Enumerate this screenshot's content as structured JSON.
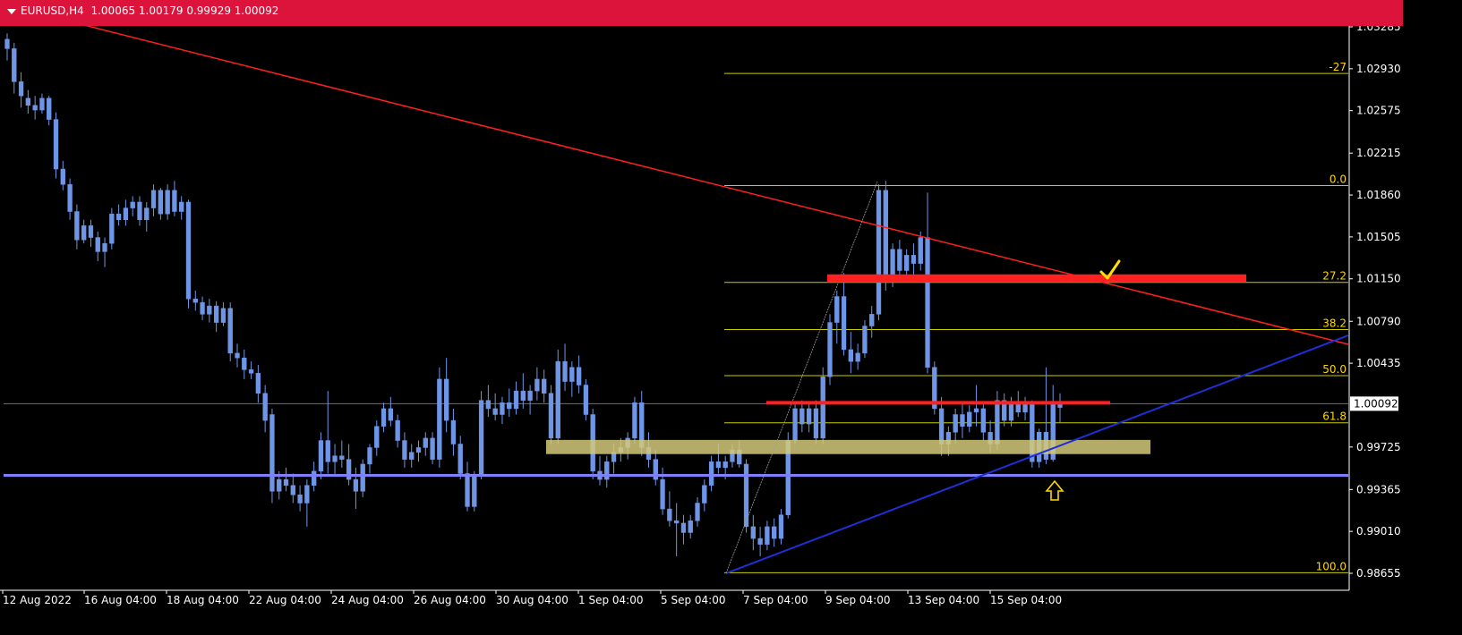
{
  "header": {
    "symbol": "EURUSD,H4",
    "ohlc": "1.00065 1.00179 0.99929 1.00092"
  },
  "current_price_label": "1.00092",
  "colors": {
    "bull": "#6f96e6",
    "bear": "#6f96e6",
    "background": "#000000",
    "fib": "#cccc00",
    "trend_red": "#ff2020",
    "trend_blue": "#1f2fd8",
    "support_line": "#8080ff",
    "zone": "#d4c97a",
    "arrow": "#ffd700"
  },
  "chart_data": {
    "type": "candlestick",
    "symbol": "EURUSD",
    "timeframe": "H4",
    "y_ticks": [
      "1.03285",
      "1.02930",
      "1.02575",
      "1.02215",
      "1.01860",
      "1.01505",
      "1.01150",
      "1.00790",
      "1.00435",
      "0.99725",
      "0.99365",
      "0.99010",
      "0.98655"
    ],
    "ylim": [
      0.9855,
      1.0338
    ],
    "x_ticks": [
      "12 Aug 2022",
      "16 Aug 04:00",
      "18 Aug 04:00",
      "22 Aug 04:00",
      "24 Aug 04:00",
      "26 Aug 04:00",
      "30 Aug 04:00",
      "1 Sep 04:00",
      "5 Sep 04:00",
      "7 Sep 04:00",
      "9 Sep 04:00",
      "13 Sep 04:00",
      "15 Sep 04:00"
    ],
    "fib_levels": [
      {
        "label": "-27",
        "price": 1.0289
      },
      {
        "label": "0.0",
        "price": 1.0194
      },
      {
        "label": "27.2",
        "price": 1.0112
      },
      {
        "label": "38.2",
        "price": 1.0072
      },
      {
        "label": "50.0",
        "price": 1.0033
      },
      {
        "label": "61.8",
        "price": 0.9993
      },
      {
        "label": "100.0",
        "price": 0.9866
      }
    ],
    "candles": [
      [
        1.0318,
        1.0323,
        1.03,
        1.031
      ],
      [
        1.031,
        1.0315,
        1.0272,
        1.0282
      ],
      [
        1.0282,
        1.029,
        1.026,
        1.027
      ],
      [
        1.0268,
        1.0275,
        1.0255,
        1.0262
      ],
      [
        1.0262,
        1.027,
        1.025,
        1.0258
      ],
      [
        1.0258,
        1.0272,
        1.0255,
        1.0268
      ],
      [
        1.0268,
        1.027,
        1.0245,
        1.025
      ],
      [
        1.025,
        1.0256,
        1.02,
        1.0208
      ],
      [
        1.0208,
        1.0215,
        1.019,
        1.0195
      ],
      [
        1.0195,
        1.02,
        1.0165,
        1.0172
      ],
      [
        1.0172,
        1.0178,
        1.014,
        1.0148
      ],
      [
        1.0148,
        1.0165,
        1.0145,
        1.016
      ],
      [
        1.016,
        1.0165,
        1.0142,
        1.015
      ],
      [
        1.015,
        1.0155,
        1.013,
        1.0138
      ],
      [
        1.0138,
        1.015,
        1.0125,
        1.0145
      ],
      [
        1.0145,
        1.0175,
        1.014,
        1.017
      ],
      [
        1.017,
        1.0178,
        1.016,
        1.0165
      ],
      [
        1.0165,
        1.0182,
        1.016,
        1.0175
      ],
      [
        1.0175,
        1.0185,
        1.0168,
        1.018
      ],
      [
        1.018,
        1.0185,
        1.016,
        1.0165
      ],
      [
        1.0165,
        1.018,
        1.0155,
        1.0175
      ],
      [
        1.0175,
        1.0195,
        1.0168,
        1.019
      ],
      [
        1.019,
        1.0192,
        1.0165,
        1.017
      ],
      [
        1.017,
        1.0195,
        1.0165,
        1.019
      ],
      [
        1.019,
        1.0198,
        1.0168,
        1.0172
      ],
      [
        1.0172,
        1.0185,
        1.0165,
        1.018
      ],
      [
        1.018,
        1.0182,
        1.009,
        1.0098
      ],
      [
        1.0098,
        1.0105,
        1.0088,
        1.0095
      ],
      [
        1.0095,
        1.01,
        1.008,
        1.0085
      ],
      [
        1.0085,
        1.0098,
        1.0078,
        1.0092
      ],
      [
        1.0092,
        1.0096,
        1.007,
        1.0078
      ],
      [
        1.0078,
        1.0095,
        1.0075,
        1.009
      ],
      [
        1.009,
        1.0095,
        1.0045,
        1.0052
      ],
      [
        1.0052,
        1.006,
        1.004,
        1.0048
      ],
      [
        1.0048,
        1.0055,
        1.003,
        1.0038
      ],
      [
        1.0038,
        1.0045,
        1.003,
        1.0035
      ],
      [
        1.0035,
        1.0042,
        1.001,
        1.0018
      ],
      [
        1.0018,
        1.0025,
        0.9985,
        0.9995
      ],
      [
        1.0,
        1.0005,
        0.9925,
        0.9935
      ],
      [
        0.9935,
        0.9952,
        0.9928,
        0.9945
      ],
      [
        0.9945,
        0.9955,
        0.9935,
        0.994
      ],
      [
        0.994,
        0.995,
        0.9925,
        0.9932
      ],
      [
        0.9932,
        0.994,
        0.9918,
        0.9925
      ],
      [
        0.9925,
        0.9945,
        0.9905,
        0.994
      ],
      [
        0.994,
        0.996,
        0.9935,
        0.9952
      ],
      [
        0.9952,
        0.9985,
        0.9945,
        0.9978
      ],
      [
        0.9978,
        1.002,
        0.995,
        0.996
      ],
      [
        0.996,
        0.9975,
        0.9948,
        0.9965
      ],
      [
        0.9965,
        0.9978,
        0.9955,
        0.9962
      ],
      [
        0.9962,
        0.9975,
        0.994,
        0.9945
      ],
      [
        0.9945,
        0.9955,
        0.992,
        0.9935
      ],
      [
        0.9935,
        0.9962,
        0.993,
        0.9958
      ],
      [
        0.9958,
        0.9975,
        0.995,
        0.9972
      ],
      [
        0.9972,
        0.9995,
        0.9965,
        0.999
      ],
      [
        0.999,
        1.001,
        0.9985,
        1.0005
      ],
      [
        1.0005,
        1.0015,
        0.999,
        0.9995
      ],
      [
        0.9995,
        1.0,
        0.9972,
        0.9978
      ],
      [
        0.9978,
        0.9985,
        0.9955,
        0.9962
      ],
      [
        0.9962,
        0.9975,
        0.9955,
        0.9968
      ],
      [
        0.9968,
        0.9978,
        0.996,
        0.9972
      ],
      [
        0.9972,
        0.9985,
        0.9965,
        0.998
      ],
      [
        0.998,
        0.9985,
        0.9958,
        0.9962
      ],
      [
        0.9962,
        1.004,
        0.9955,
        1.003
      ],
      [
        1.003,
        1.0048,
        0.9985,
        0.9995
      ],
      [
        0.9995,
        1.0005,
        0.9965,
        0.9975
      ],
      [
        0.9975,
        0.9982,
        0.9945,
        0.995
      ],
      [
        0.995,
        0.996,
        0.9918,
        0.9922
      ],
      [
        0.9922,
        0.9952,
        0.9918,
        0.9948
      ],
      [
        0.9948,
        1.002,
        0.9945,
        1.0012
      ],
      [
        1.0012,
        1.0025,
        0.9998,
        1.0005
      ],
      [
        1.0005,
        1.0018,
        0.9995,
        1.0
      ],
      [
        1.0,
        1.0015,
        0.9992,
        1.001
      ],
      [
        1.001,
        1.0022,
        0.9998,
        1.0005
      ],
      [
        1.0005,
        1.0028,
        1.0,
        1.002
      ],
      [
        1.002,
        1.0035,
        1.0005,
        1.0012
      ],
      [
        1.0012,
        1.0025,
        1.0,
        1.002
      ],
      [
        1.002,
        1.004,
        1.0012,
        1.003
      ],
      [
        1.003,
        1.0038,
        1.001,
        1.0018
      ],
      [
        1.0018,
        1.0025,
        0.9975,
        0.998
      ],
      [
        0.998,
        1.0055,
        0.9975,
        1.0045
      ],
      [
        1.0045,
        1.006,
        1.002,
        1.0028
      ],
      [
        1.0028,
        1.0045,
        1.0015,
        1.004
      ],
      [
        1.004,
        1.005,
        1.0018,
        1.0025
      ],
      [
        1.0025,
        1.003,
        0.9995,
        1.0
      ],
      [
        1.0,
        1.0005,
        0.9945,
        0.9952
      ],
      [
        0.9952,
        0.9965,
        0.994,
        0.9945
      ],
      [
        0.9945,
        0.9965,
        0.9938,
        0.996
      ],
      [
        0.996,
        0.9975,
        0.995,
        0.9968
      ],
      [
        0.9968,
        0.998,
        0.996,
        0.9972
      ],
      [
        0.9972,
        0.9985,
        0.9962,
        0.998
      ],
      [
        0.998,
        1.0015,
        0.9975,
        1.001
      ],
      [
        1.001,
        1.002,
        0.9965,
        0.9972
      ],
      [
        0.9972,
        0.9985,
        0.9955,
        0.9962
      ],
      [
        0.9962,
        0.997,
        0.994,
        0.9945
      ],
      [
        0.9945,
        0.9955,
        0.9915,
        0.992
      ],
      [
        0.992,
        0.9935,
        0.9905,
        0.991
      ],
      [
        0.991,
        0.9925,
        0.988,
        0.9908
      ],
      [
        0.9908,
        0.9915,
        0.989,
        0.99
      ],
      [
        0.99,
        0.9915,
        0.9895,
        0.991
      ],
      [
        0.991,
        0.993,
        0.9905,
        0.9925
      ],
      [
        0.9925,
        0.9945,
        0.9918,
        0.994
      ],
      [
        0.994,
        0.9965,
        0.9935,
        0.996
      ],
      [
        0.996,
        0.9975,
        0.995,
        0.9955
      ],
      [
        0.9955,
        0.9965,
        0.9945,
        0.996
      ],
      [
        0.996,
        0.9975,
        0.9955,
        0.997
      ],
      [
        0.997,
        0.9978,
        0.9955,
        0.9958
      ],
      [
        0.9958,
        0.9962,
        0.99,
        0.9905
      ],
      [
        0.9905,
        0.9915,
        0.9885,
        0.9895
      ],
      [
        0.9895,
        0.9905,
        0.988,
        0.989
      ],
      [
        0.989,
        0.991,
        0.9885,
        0.9905
      ],
      [
        0.9905,
        0.9912,
        0.9888,
        0.9895
      ],
      [
        0.9895,
        0.992,
        0.989,
        0.9915
      ],
      [
        0.9915,
        0.9985,
        0.9912,
        0.9978
      ],
      [
        0.9978,
        1.001,
        0.9975,
        1.0005
      ],
      [
        1.0005,
        1.0012,
        0.9985,
        0.9992
      ],
      [
        0.9992,
        1.001,
        0.9985,
        1.0005
      ],
      [
        1.0005,
        1.0012,
        0.9975,
        0.998
      ],
      [
        0.998,
        1.004,
        0.9975,
        1.0032
      ],
      [
        1.0032,
        1.0085,
        1.0025,
        1.0078
      ],
      [
        1.0078,
        1.0105,
        1.006,
        1.01
      ],
      [
        1.01,
        1.012,
        1.005,
        1.0055
      ],
      [
        1.0055,
        1.007,
        1.0035,
        1.0045
      ],
      [
        1.0045,
        1.006,
        1.0038,
        1.0052
      ],
      [
        1.0052,
        1.008,
        1.0048,
        1.0075
      ],
      [
        1.0075,
        1.0092,
        1.0065,
        1.0085
      ],
      [
        1.0085,
        1.0195,
        1.008,
        1.019
      ],
      [
        1.019,
        1.0198,
        1.0105,
        1.0115
      ],
      [
        1.0115,
        1.0145,
        1.0108,
        1.014
      ],
      [
        1.014,
        1.0148,
        1.0115,
        1.0122
      ],
      [
        1.0122,
        1.014,
        1.0118,
        1.0135
      ],
      [
        1.0135,
        1.0145,
        1.0115,
        1.0128
      ],
      [
        1.0128,
        1.0155,
        1.0122,
        1.015
      ],
      [
        1.015,
        1.0188,
        1.0035,
        1.004
      ],
      [
        1.004,
        1.0045,
        1.0,
        1.0005
      ],
      [
        1.0005,
        1.0015,
        0.9965,
        0.9975
      ],
      [
        0.9975,
        0.999,
        0.9965,
        0.9985
      ],
      [
        0.9985,
        1.0005,
        0.9975,
        1.0
      ],
      [
        1.0,
        1.001,
        0.998,
        0.999
      ],
      [
        0.999,
        1.0008,
        0.9985,
        1.0002
      ],
      [
        1.0002,
        1.0025,
        0.999,
        1.0005
      ],
      [
        1.0005,
        1.001,
        0.9978,
        0.9985
      ],
      [
        0.9985,
        0.9995,
        0.9968,
        0.9975
      ],
      [
        0.9975,
        1.002,
        0.997,
        1.0012
      ],
      [
        1.0012,
        1.0018,
        0.999,
        0.9995
      ],
      [
        0.9995,
        1.0015,
        0.999,
        1.001
      ],
      [
        1.001,
        1.002,
        0.9998,
        1.0002
      ],
      [
        1.0002,
        1.0015,
        0.9995,
        1.001
      ],
      [
        1.001,
        1.0012,
        0.9955,
        0.996
      ],
      [
        0.996,
        0.9988,
        0.9955,
        0.9985
      ],
      [
        0.9985,
        1.004,
        0.9958,
        0.9962
      ],
      [
        0.9962,
        1.0025,
        0.996,
        1.001
      ],
      [
        1.0006,
        1.0018,
        0.9993,
        1.0009
      ]
    ]
  }
}
